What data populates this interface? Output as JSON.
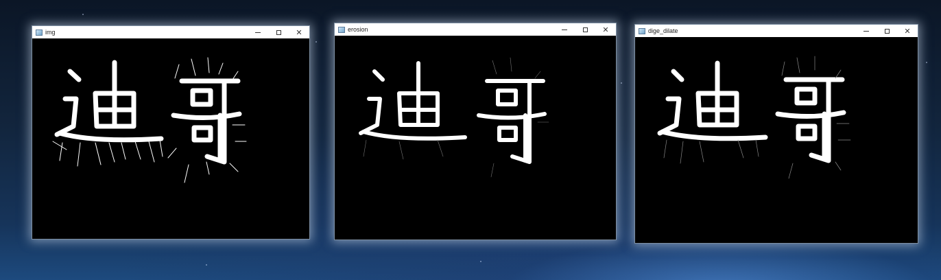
{
  "windows": [
    {
      "title": "img",
      "icon": "opencv-window-icon"
    },
    {
      "title": "erosion",
      "icon": "opencv-window-icon"
    },
    {
      "title": "dige_dilate",
      "icon": "opencv-window-icon"
    }
  ],
  "glyph_text": "迪哥",
  "colors": {
    "stroke": "#ffffff",
    "canvas": "#000000",
    "titlebar": "#ffffff"
  }
}
